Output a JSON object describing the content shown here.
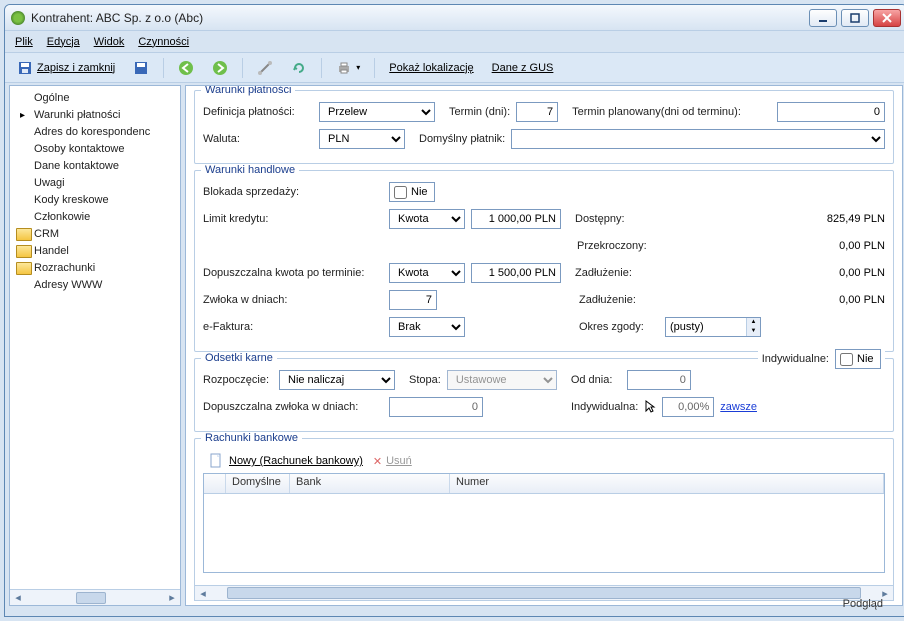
{
  "window": {
    "title": "Kontrahent: ABC Sp. z o.o (Abc)"
  },
  "menubar": [
    "Plik",
    "Edycja",
    "Widok",
    "Czynności"
  ],
  "toolbar": {
    "save_close": "Zapisz i zamknij",
    "show_loc": "Pokaż lokalizację",
    "gus": "Dane z GUS"
  },
  "sidebar": {
    "items": [
      {
        "label": "Ogólne"
      },
      {
        "label": "Warunki płatności",
        "selected": true
      },
      {
        "label": "Adres do korespondenc"
      },
      {
        "label": "Osoby kontaktowe"
      },
      {
        "label": "Dane kontaktowe"
      },
      {
        "label": "Uwagi"
      },
      {
        "label": "Kody kreskowe"
      },
      {
        "label": "Członkowie"
      },
      {
        "label": "CRM",
        "folder": true
      },
      {
        "label": "Handel",
        "folder": true
      },
      {
        "label": "Rozrachunki",
        "folder": true
      },
      {
        "label": "Adresy WWW"
      }
    ]
  },
  "payment": {
    "group_title": "Warunki płatności",
    "def_lbl": "Definicja płatności:",
    "def_val": "Przelew",
    "term_lbl": "Termin (dni):",
    "term_val": "7",
    "planned_lbl": "Termin planowany(dni od terminu):",
    "planned_val": "0",
    "currency_lbl": "Waluta:",
    "currency_val": "PLN",
    "defpayer_lbl": "Domyślny płatnik:"
  },
  "trade": {
    "group_title": "Warunki handlowe",
    "block_lbl": "Blokada sprzedaży:",
    "block_val": "Nie",
    "limit_lbl": "Limit kredytu:",
    "limit_type": "Kwota",
    "limit_val": "1 000,00 PLN",
    "avail_lbl": "Dostępny:",
    "avail_val": "825,49 PLN",
    "overrun_lbl": "Przekroczony:",
    "overrun_val": "0,00 PLN",
    "overdue_lbl": "Dopuszczalna kwota po terminie:",
    "overdue_type": "Kwota",
    "overdue_val": "1 500,00 PLN",
    "debt_lbl": "Zadłużenie:",
    "debt_val": "0,00 PLN",
    "delay_lbl": "Zwłoka w dniach:",
    "delay_val": "7",
    "debt2_lbl": "Zadłużenie:",
    "debt2_val": "0,00 PLN",
    "einv_lbl": "e-Faktura:",
    "einv_val": "Brak",
    "consent_lbl": "Okres zgody:",
    "consent_val": "(pusty)"
  },
  "interest": {
    "group_title": "Odsetki karne",
    "indiv_lbl": "Indywidualne:",
    "indiv_val": "Nie",
    "start_lbl": "Rozpoczęcie:",
    "start_val": "Nie naliczaj",
    "rate_lbl": "Stopa:",
    "rate_val": "Ustawowe",
    "from_lbl": "Od dnia:",
    "from_val": "0",
    "delay_lbl": "Dopuszczalna zwłoka w dniach:",
    "delay_val": "0",
    "indiv2_lbl": "Indywidualna:",
    "indiv2_val": "0,00%",
    "always": "zawsze"
  },
  "banks": {
    "group_title": "Rachunki bankowe",
    "new": "Nowy (Rachunek bankowy)",
    "del": "Usuń",
    "cols": [
      "",
      "Domyślne",
      "Bank",
      "Numer"
    ]
  },
  "statusbar": "Podgląd"
}
